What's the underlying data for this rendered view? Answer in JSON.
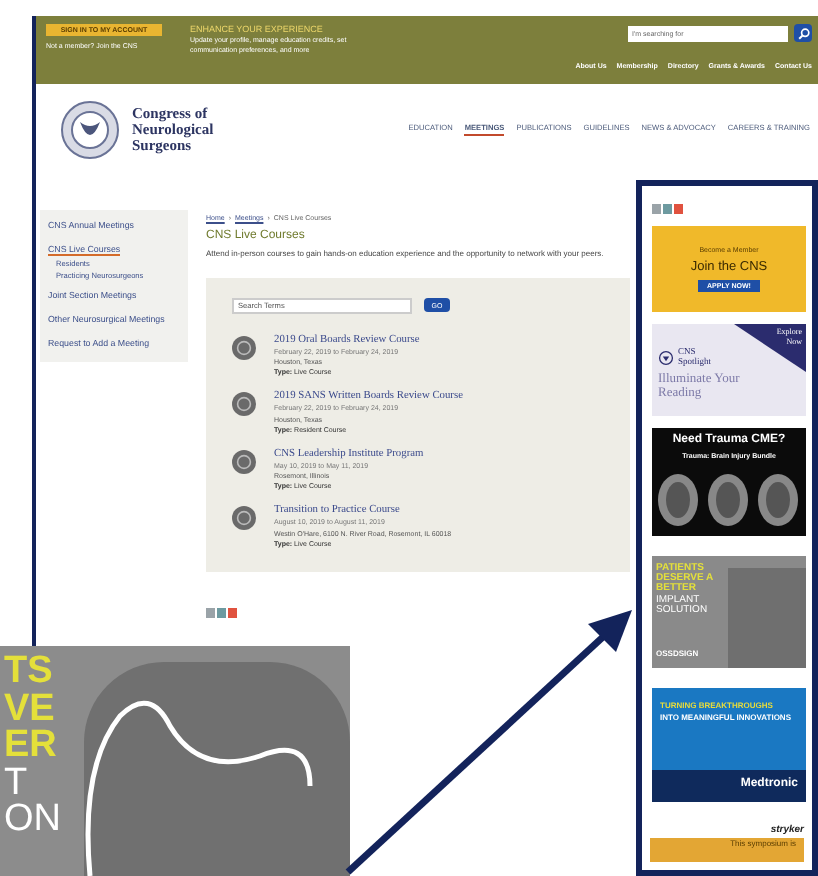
{
  "top_bar": {
    "sign_in": "SIGN IN TO MY ACCOUNT",
    "join": "Not a member? Join the CNS",
    "promo_title": "ENHANCE YOUR EXPERIENCE",
    "promo_text": "Update your profile, manage education credits, set communication preferences, and more",
    "search": {
      "placeholder": "I'm searching for"
    },
    "links": [
      "About Us",
      "Membership",
      "Directory",
      "Grants & Awards",
      "Contact Us"
    ]
  },
  "logo": {
    "name": "Congress of Neurological Surgeons"
  },
  "main_nav": [
    {
      "label": "EDUCATION",
      "selected": false
    },
    {
      "label": "MEETINGS",
      "selected": true
    },
    {
      "label": "PUBLICATIONS",
      "selected": false
    },
    {
      "label": "GUIDELINES",
      "selected": false
    },
    {
      "label": "NEWS & ADVOCACY",
      "selected": false
    },
    {
      "label": "CAREERS & TRAINING",
      "selected": false
    }
  ],
  "sidebar": {
    "items": [
      {
        "label": "CNS Annual Meetings",
        "selected": false
      },
      {
        "label": "CNS Live Courses",
        "selected": true,
        "children": [
          {
            "label": "Residents",
            "selected": false
          },
          {
            "label": "Practicing Neurosurgeons",
            "selected": false
          }
        ]
      },
      {
        "label": "Joint Section Meetings",
        "selected": false
      },
      {
        "label": "Other Neurosurgical Meetings",
        "selected": false
      },
      {
        "label": "Request to Add a Meeting",
        "selected": false
      }
    ]
  },
  "breadcrumb": {
    "separator": "›",
    "items": [
      "Home",
      "Meetings",
      "CNS Live Courses"
    ]
  },
  "page_title": "CNS Live Courses",
  "intro": "Attend in-person courses to gain hands-on education experience and the opportunity to network with your peers.",
  "course_search": {
    "placeholder": "Search Terms",
    "button": "GO"
  },
  "courses": [
    {
      "title": "2019 Oral Boards Review Course",
      "dates": "February 22, 2019 to February 24, 2019",
      "location": "Houston, Texas",
      "type": "**Type:** Live Course"
    },
    {
      "title": "2019 SANS Written Boards Review Course",
      "dates": "February 22, 2019 to February 24, 2019",
      "location": "Houston, Texas",
      "type": "**Type:** Resident Course"
    },
    {
      "title": "CNS Leadership Institute Program",
      "dates": "May 10, 2019 to May 11, 2019",
      "location": "Rosemont, Illinois",
      "type": "**Type:** Live Course"
    },
    {
      "title": "Transition to Practice Course",
      "dates": "August 10, 2019 to August 11, 2019",
      "location": "Westin O'Hare, 6100 N. River Road, Rosemont, IL 60018",
      "type": "**Type:** Live Course"
    }
  ],
  "ads": [
    {
      "kind": "member",
      "eyebrow": "Become a Member",
      "title": "Join the CNS",
      "button": "APPLY NOW!"
    },
    {
      "kind": "spotlight",
      "corner": "Explore Now",
      "logo": "CNS Spotlight",
      "tagline": "Illuminate Your Reading"
    },
    {
      "kind": "trauma",
      "title": "Need Trauma CME?",
      "subtitle": "Trauma: Brain Injury Bundle"
    },
    {
      "kind": "implant",
      "headline": "PATIENTS DESERVE A BETTER",
      "subline": "IMPLANT SOLUTION",
      "brand": "OSSDSIGN"
    },
    {
      "kind": "medtronic",
      "headline": "TURNING BREAKTHROUGHS",
      "subline": "INTO MEANINGFUL INNOVATIONS",
      "brand": "Medtronic"
    },
    {
      "kind": "stryker",
      "brand": "stryker",
      "caption": "This symposium is"
    }
  ],
  "inset": {
    "lines": [
      {
        "text": "TS",
        "highlighted": true
      },
      {
        "text": "VE",
        "highlighted": true
      },
      {
        "text": "ER",
        "highlighted": true
      },
      {
        "text": "T",
        "highlighted": false
      },
      {
        "text": "ON",
        "highlighted": false
      }
    ]
  }
}
